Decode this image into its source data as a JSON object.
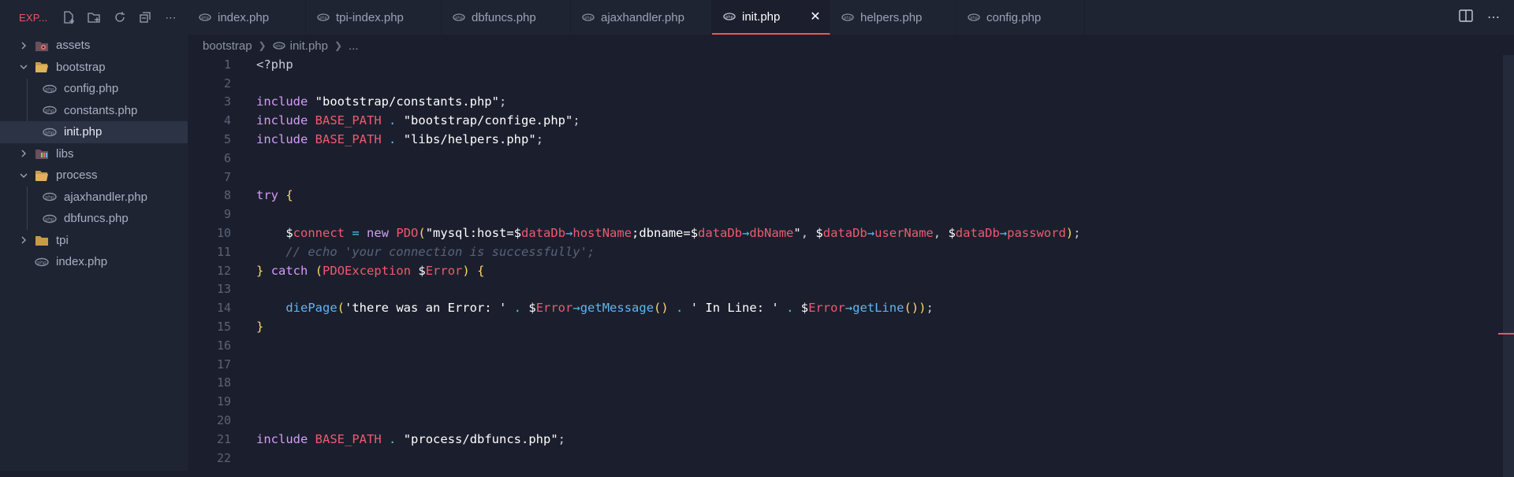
{
  "sidebar": {
    "title": "EXP...",
    "tree": [
      {
        "label": "assets",
        "type": "folder",
        "expanded": false,
        "icon": "assets-folder-icon",
        "depth": 0
      },
      {
        "label": "bootstrap",
        "type": "folder",
        "expanded": true,
        "icon": "folder-open-icon",
        "depth": 0
      },
      {
        "label": "config.php",
        "type": "file",
        "icon": "php-file-icon",
        "depth": 1
      },
      {
        "label": "constants.php",
        "type": "file",
        "icon": "php-file-icon",
        "depth": 1
      },
      {
        "label": "init.php",
        "type": "file",
        "icon": "php-file-icon",
        "depth": 1,
        "selected": true
      },
      {
        "label": "libs",
        "type": "folder",
        "expanded": false,
        "icon": "libs-folder-icon",
        "depth": 0
      },
      {
        "label": "process",
        "type": "folder",
        "expanded": true,
        "icon": "folder-open-icon",
        "depth": 0
      },
      {
        "label": "ajaxhandler.php",
        "type": "file",
        "icon": "php-file-icon",
        "depth": 1
      },
      {
        "label": "dbfuncs.php",
        "type": "file",
        "icon": "php-file-icon",
        "depth": 1
      },
      {
        "label": "tpi",
        "type": "folder",
        "expanded": false,
        "icon": "folder-icon",
        "depth": 0
      },
      {
        "label": "index.php",
        "type": "file",
        "icon": "php-file-icon",
        "depth": 0
      }
    ]
  },
  "tabs": [
    {
      "label": "index.php"
    },
    {
      "label": "tpi-index.php"
    },
    {
      "label": "dbfuncs.php"
    },
    {
      "label": "ajaxhandler.php"
    },
    {
      "label": "init.php",
      "active": true
    },
    {
      "label": "helpers.php"
    },
    {
      "label": "config.php"
    }
  ],
  "breadcrumb": {
    "folder": "bootstrap",
    "file": "init.php",
    "more": "..."
  },
  "editor": {
    "line_numbers": [
      "1",
      "2",
      "3",
      "4",
      "5",
      "6",
      "7",
      "8",
      "9",
      "10",
      "11",
      "12",
      "13",
      "14",
      "15",
      "16",
      "17",
      "18",
      "19",
      "20",
      "21",
      "22"
    ]
  },
  "colors": {
    "accent": "#f0555b",
    "background": "#1b1f2d",
    "sidebar": "#1f2433"
  }
}
